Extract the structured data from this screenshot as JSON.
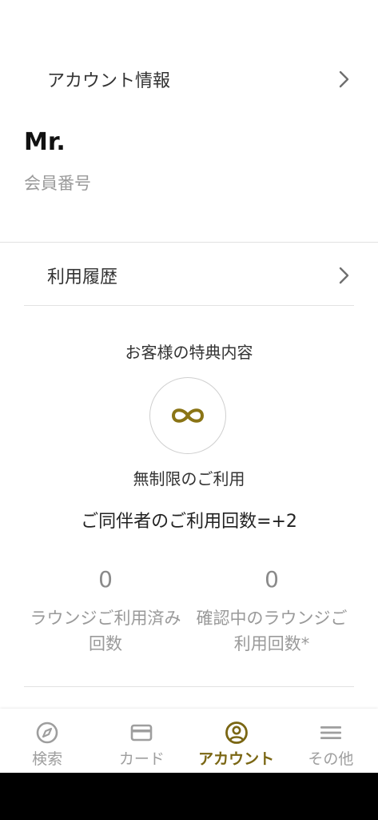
{
  "account_row": {
    "label": "アカウント情報"
  },
  "member": {
    "name": "Mr. ",
    "number_label": "会員番号"
  },
  "history_row": {
    "label": "利用履歴"
  },
  "benefits": {
    "title": "お客様の特典内容",
    "icon": "infinity-icon",
    "name": "無制限のご利用",
    "companion": "ご同伴者のご利用回数=+2"
  },
  "stats": [
    {
      "value": "0",
      "label": "ラウンジご利用済み回数"
    },
    {
      "value": "0",
      "label": "確認中のラウンジご利用回数*"
    }
  ],
  "bottom_nav": {
    "items": [
      {
        "label": "検索",
        "icon": "compass-icon",
        "active": false
      },
      {
        "label": "カード",
        "icon": "card-icon",
        "active": false
      },
      {
        "label": "アカウント",
        "icon": "account-icon",
        "active": true
      },
      {
        "label": "その他",
        "icon": "menu-icon",
        "active": false
      }
    ]
  },
  "colors": {
    "accent": "#7a6613",
    "inactive": "#9e9e9e",
    "divider": "#e2e2e2",
    "infinity": "#8a7415"
  }
}
